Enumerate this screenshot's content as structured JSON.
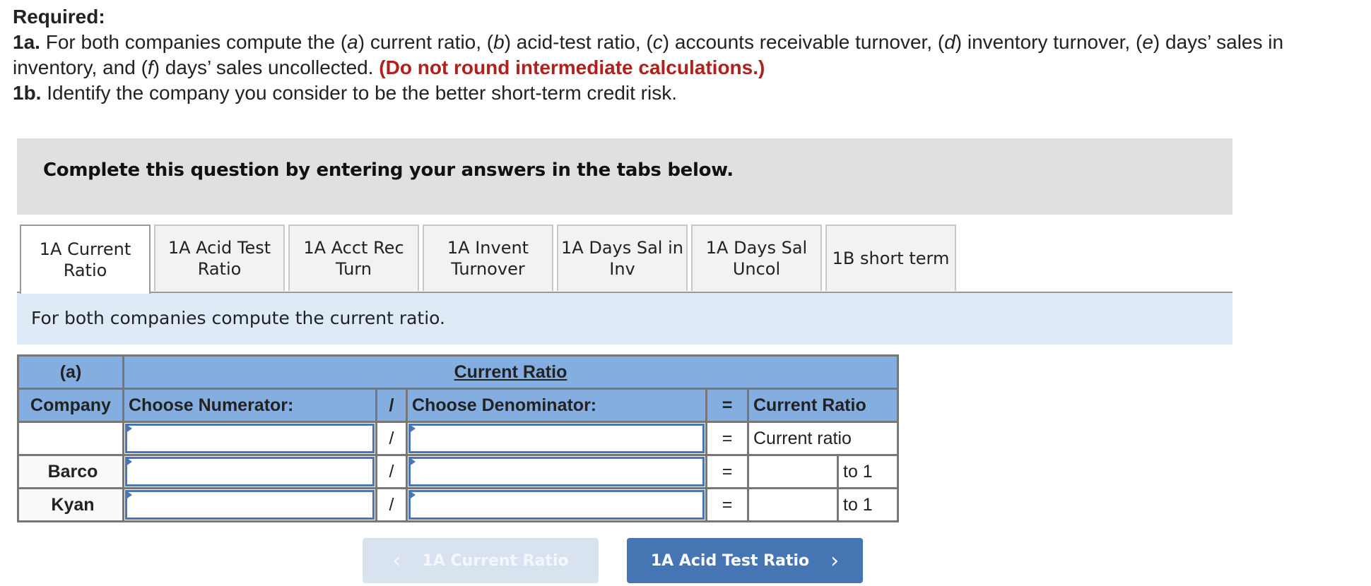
{
  "required": {
    "title": "Required:",
    "line1a_label": "1a.",
    "line1a_parts": {
      "p1": " For both companies compute the (",
      "a": "a",
      "p2": ") current ratio, (",
      "b": "b",
      "p3": ") acid-test ratio, (",
      "c": "c",
      "p4": ") accounts receivable turnover, (",
      "d": "d",
      "p5": ") inventory turnover, (",
      "e": "e",
      "p6": ") days’ sales in inventory, and (",
      "f": "f",
      "p7": ") days’ sales uncollected. "
    },
    "line1a_note": "(Do not round intermediate calculations.)",
    "line1b_label": "1b.",
    "line1b_text": " Identify the company you consider to be the better short-term credit risk."
  },
  "instructions": "Complete this question by entering your answers in the tabs below.",
  "tabs": [
    {
      "label": "1A Current Ratio",
      "active": true
    },
    {
      "label": "1A Acid Test Ratio",
      "active": false
    },
    {
      "label": "1A Acct Rec Turn",
      "active": false
    },
    {
      "label": "1A Invent Turnover",
      "active": false
    },
    {
      "label": "1A Days Sal in Inv",
      "active": false
    },
    {
      "label": "1A Days Sal Uncol",
      "active": false
    },
    {
      "label": "1B short term",
      "active": false
    }
  ],
  "prompt": "For both companies compute the current ratio.",
  "table": {
    "part_label": "(a)",
    "title": "Current Ratio",
    "headers": {
      "company": "Company",
      "numerator": "Choose Numerator:",
      "slash": "/",
      "denominator": "Choose Denominator:",
      "equals": "=",
      "result": "Current Ratio"
    },
    "formula_row": {
      "company": "",
      "numerator": "",
      "denominator": "",
      "result_label": "Current ratio"
    },
    "rows": [
      {
        "company": "Barco",
        "numerator": "",
        "denominator": "",
        "value": "",
        "suffix": "to 1"
      },
      {
        "company": "Kyan",
        "numerator": "",
        "denominator": "",
        "value": "",
        "suffix": "to 1"
      }
    ],
    "slash": "/",
    "equals": "="
  },
  "nav": {
    "prev_label": "1A Current Ratio",
    "next_label": "1A Acid Test Ratio",
    "prev_enabled": false,
    "next_enabled": true
  },
  "icons": {
    "prev": "chevron-left-icon",
    "next": "chevron-right-icon"
  },
  "colors": {
    "accent": "#4675b3",
    "header_blue": "#84ade0",
    "note_red": "#b0211c",
    "prompt_bg": "#deebf7"
  }
}
